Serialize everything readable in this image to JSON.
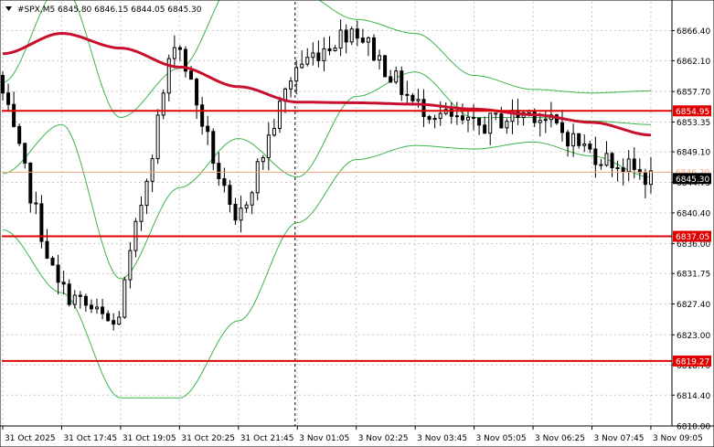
{
  "header": {
    "title": "#SPX,M5  6845.80 6846.15 6844.05 6845.30"
  },
  "colors": {
    "background": "#ffffff",
    "foreground": "#000000",
    "grid": "#c8c8c8",
    "candle": "#000000",
    "moving_average": "#c8102e",
    "bollinger": "#3cb44b",
    "level_line": "#e00000",
    "bid_line": "#f4a27a"
  },
  "chart_data": {
    "type": "line",
    "title": "#SPX,M5",
    "ohlc_readout": {
      "open": 6845.8,
      "high": 6846.15,
      "low": 6844.05,
      "close": 6845.3
    },
    "ylim": [
      6810.0,
      6870.5
    ],
    "y_ticks": [
      "6866.40",
      "6862.10",
      "6857.70",
      "6853.35",
      "6849.10",
      "6844.75",
      "6840.40",
      "6836.00",
      "6831.75",
      "6827.40",
      "6823.00",
      "6818.70",
      "6814.40",
      "6810.00"
    ],
    "x_ticks": [
      "31 Oct 2025",
      "31 Oct 17:45",
      "31 Oct 19:05",
      "31 Oct 20:25",
      "31 Oct 21:45",
      "3 Nov 01:05",
      "3 Nov 02:25",
      "3 Nov 03:45",
      "3 Nov 05:05",
      "3 Nov 06:25",
      "3 Nov 07:45",
      "3 Nov 09:05"
    ],
    "session_break": "31 Oct 21:45",
    "grid": true,
    "horizontal_levels": [
      {
        "label": "6854.95",
        "value": 6854.95
      },
      {
        "label": "6837.05",
        "value": 6837.05
      },
      {
        "label": "6819.27",
        "value": 6819.27
      }
    ],
    "bid_line": {
      "label": "6846.20",
      "value": 6846.2
    },
    "last_price": {
      "label": "6845.30",
      "value": 6845.3
    },
    "series": [
      {
        "type": "line",
        "values_at_x_ticks": [
          6863.1,
          6866.0,
          6863.9,
          6861.2,
          6858.4,
          6856.2,
          6856.1,
          6855.9,
          6855.2,
          6854.4,
          6853.3,
          6851.5
        ]
      },
      {
        "type": "band",
        "upper_at_x_ticks": [
          6859.0,
          6873.0,
          6854.0,
          6861.0,
          6874.0,
          6872.0,
          6868.0,
          6866.0,
          6860.0,
          6858.0,
          6857.5,
          6857.8
        ],
        "middle_at_x_ticks": [
          6846.0,
          6853.0,
          6831.0,
          6844.0,
          6851.0,
          6845.5,
          6857.0,
          6860.5,
          6854.0,
          6854.0,
          6853.5,
          6853.0
        ],
        "lower_at_x_ticks": [
          6838.0,
          6829.0,
          6814.0,
          6814.0,
          6825.0,
          6839.0,
          6848.0,
          6850.0,
          6849.5,
          6850.5,
          6848.5,
          6845.5
        ]
      }
    ],
    "price_path_at_x_ticks": [
      6860.0,
      6830.0,
      6824.0,
      6866.0,
      6838.0,
      6861.0,
      6867.0,
      6856.0,
      6852.5,
      6855.0,
      6849.0,
      6845.3
    ],
    "candle_count": 118
  }
}
